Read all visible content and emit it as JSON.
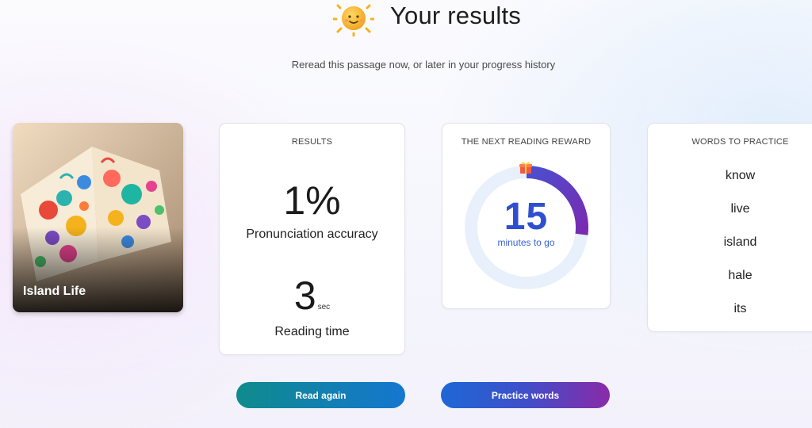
{
  "header": {
    "title": "Your results",
    "subtitle": "Reread this passage now, or later in your progress history"
  },
  "book": {
    "title": "Island Life"
  },
  "results": {
    "heading": "RESULTS",
    "accuracy_value": "1%",
    "accuracy_label": "Pronunciation accuracy",
    "time_value": "3",
    "time_unit": "sec",
    "time_label": "Reading time"
  },
  "reward": {
    "heading": "THE NEXT READING REWARD",
    "minutes": "15",
    "label": "minutes to go",
    "progress_fraction": 0.27
  },
  "practice": {
    "heading": "WORDS TO PRACTICE",
    "words": [
      "know",
      "live",
      "island",
      "hale",
      "its"
    ]
  },
  "buttons": {
    "read_again": "Read again",
    "practice_words": "Practice words"
  },
  "colors": {
    "read_again_start": "#0f8b8d",
    "read_again_end": "#1576d0",
    "practice_start": "#1e67d6",
    "practice_end": "#8a2aa8",
    "ring_track": "#e8f0fb",
    "ring_progress": "#6a2fb8"
  }
}
